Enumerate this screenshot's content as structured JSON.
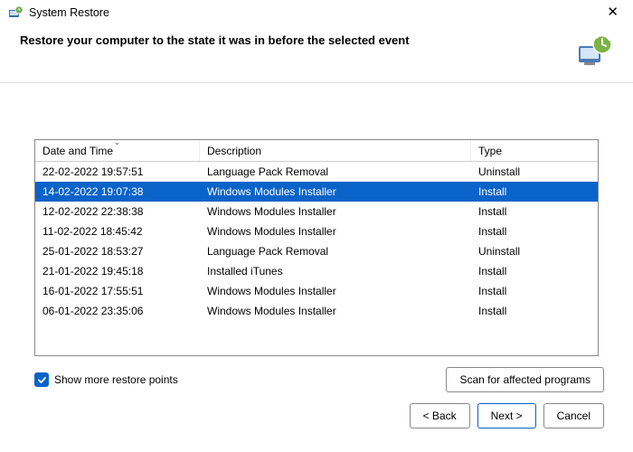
{
  "window": {
    "title": "System Restore",
    "heading": "Restore your computer to the state it was in before the selected event"
  },
  "columns": {
    "date": "Date and Time",
    "desc": "Description",
    "type": "Type"
  },
  "rows": [
    {
      "date": "22-02-2022 19:57:51",
      "desc": "Language Pack Removal",
      "type": "Uninstall",
      "selected": false
    },
    {
      "date": "14-02-2022 19:07:38",
      "desc": "Windows Modules Installer",
      "type": "Install",
      "selected": true
    },
    {
      "date": "12-02-2022 22:38:38",
      "desc": "Windows Modules Installer",
      "type": "Install",
      "selected": false
    },
    {
      "date": "11-02-2022 18:45:42",
      "desc": "Windows Modules Installer",
      "type": "Install",
      "selected": false
    },
    {
      "date": "25-01-2022 18:53:27",
      "desc": "Language Pack Removal",
      "type": "Uninstall",
      "selected": false
    },
    {
      "date": "21-01-2022 19:45:18",
      "desc": "Installed iTunes",
      "type": "Install",
      "selected": false
    },
    {
      "date": "16-01-2022 17:55:51",
      "desc": "Windows Modules Installer",
      "type": "Install",
      "selected": false
    },
    {
      "date": "06-01-2022 23:35:06",
      "desc": "Windows Modules Installer",
      "type": "Install",
      "selected": false
    }
  ],
  "checkbox": {
    "label": "Show more restore points",
    "checked": true
  },
  "buttons": {
    "scan": "Scan for affected programs",
    "back": "< Back",
    "next": "Next >",
    "cancel": "Cancel"
  }
}
